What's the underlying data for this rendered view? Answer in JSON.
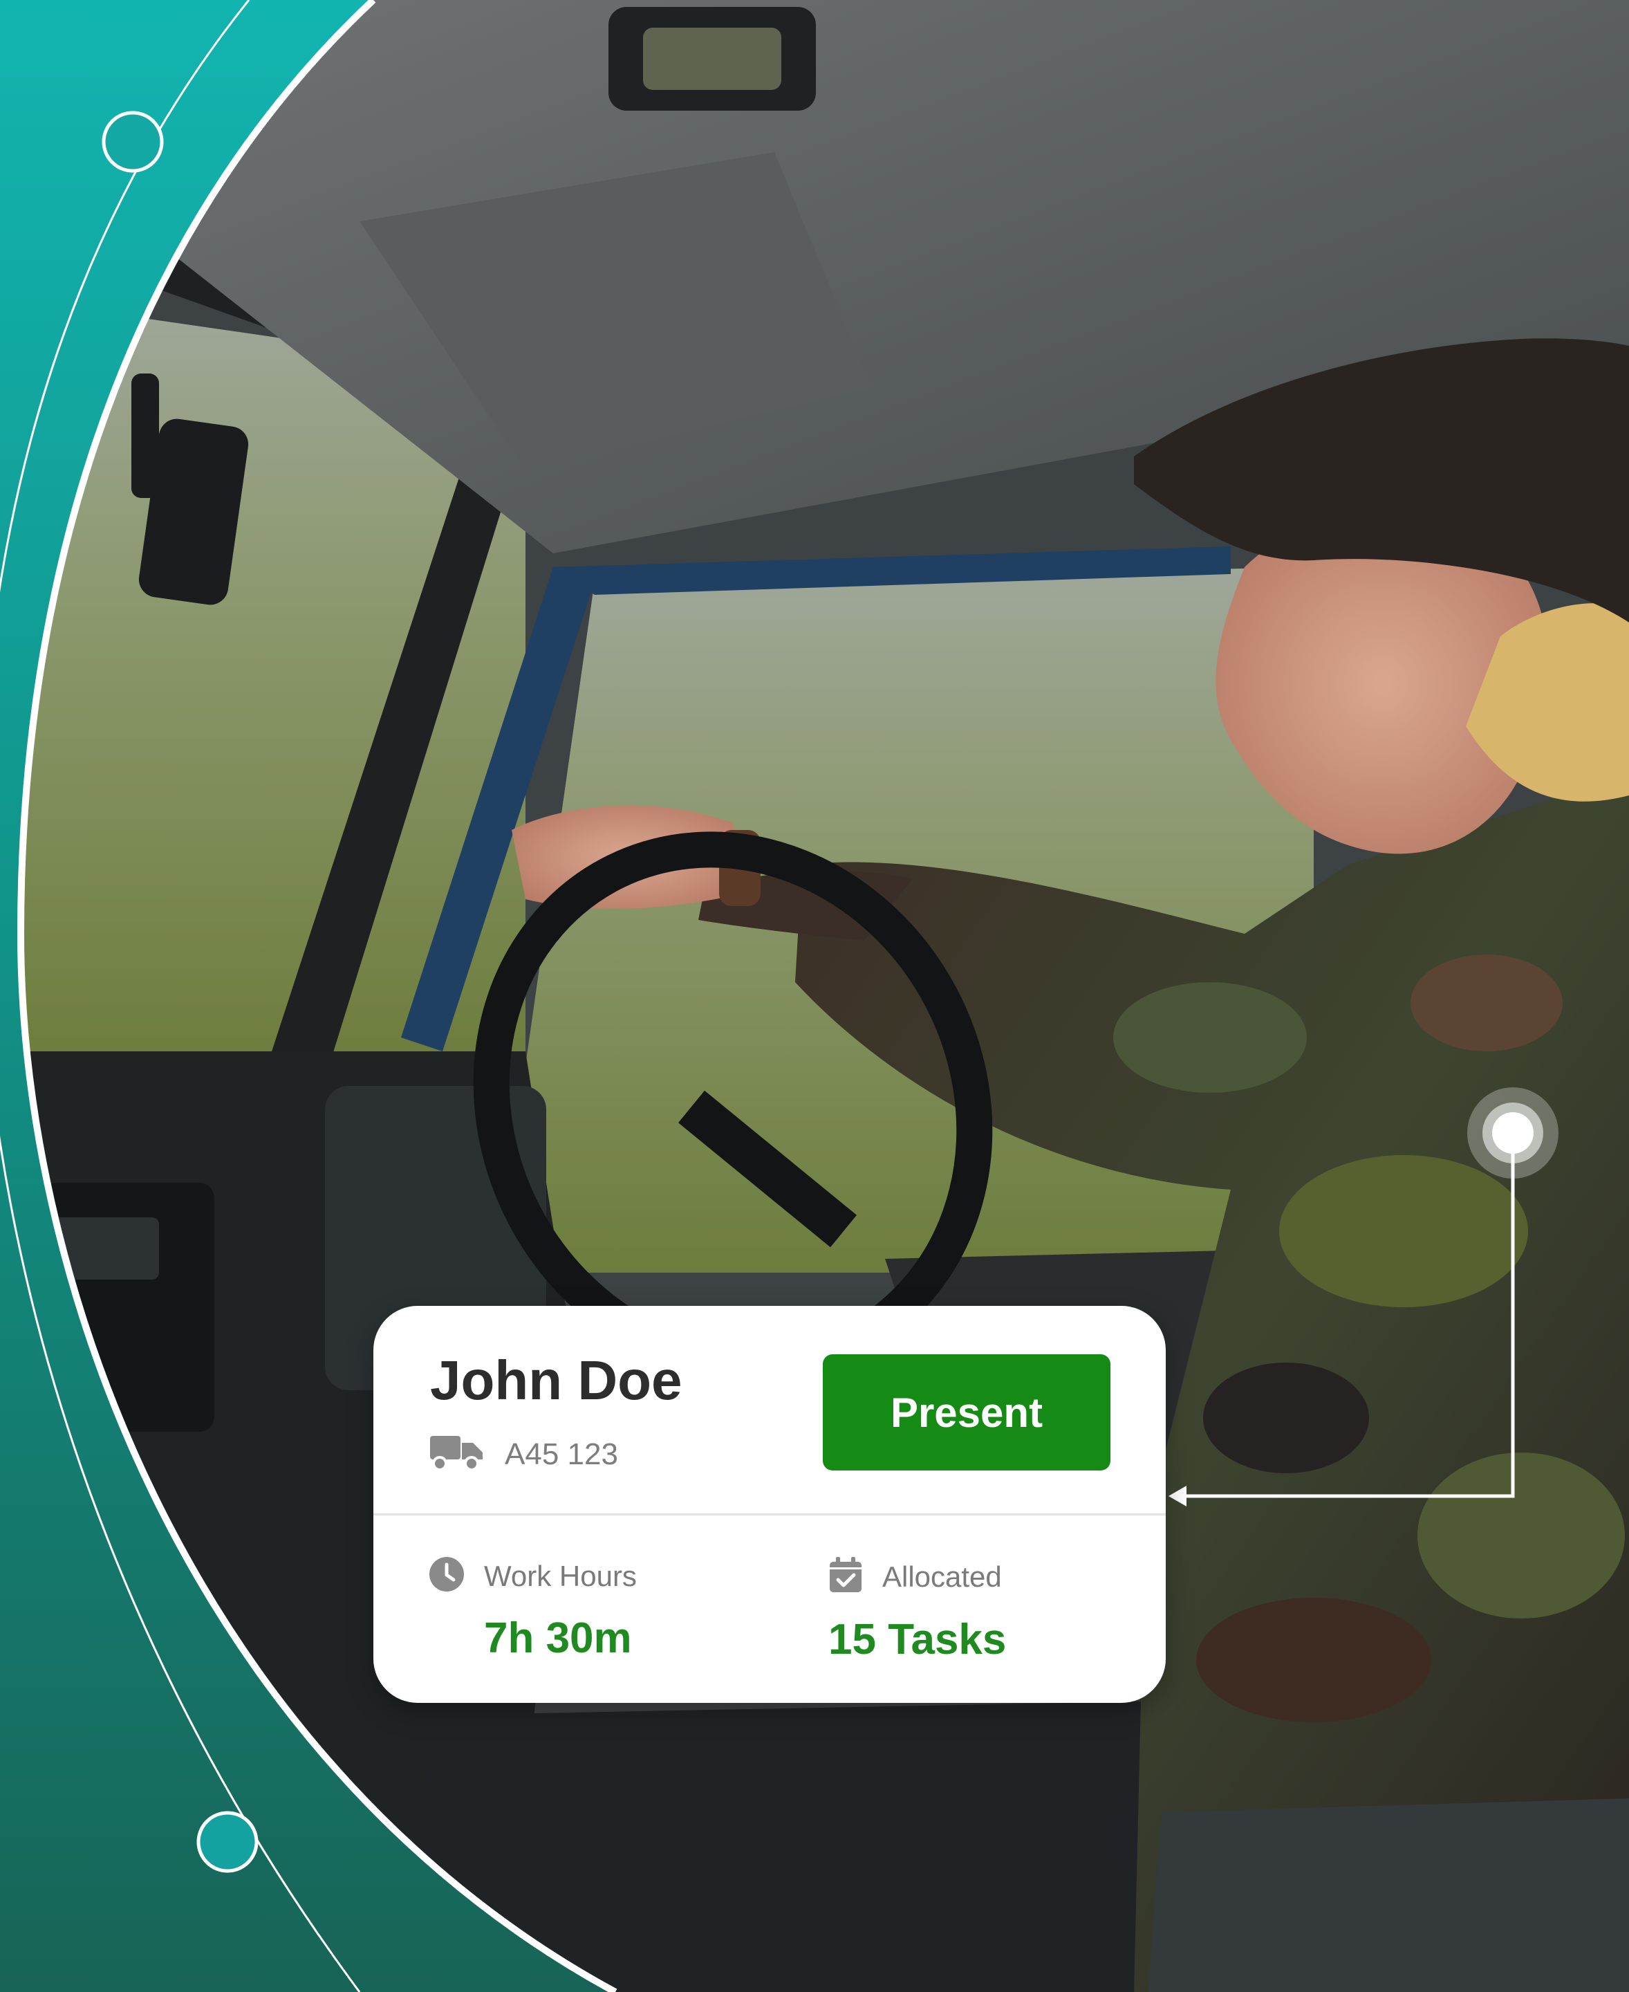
{
  "driver": {
    "name": "John Doe",
    "vehicle_id": "A45 123",
    "status": "Present"
  },
  "stats": {
    "work_hours": {
      "label": "Work Hours",
      "value": "7h 30m"
    },
    "allocated": {
      "label": "Allocated",
      "value": "15 Tasks"
    }
  },
  "icons": {
    "vehicle": "truck-icon",
    "work_hours": "clock-icon",
    "allocated": "calendar-check-icon"
  },
  "colors": {
    "brand_teal": "#10b0ad",
    "brand_dark_teal": "#166b5f",
    "status_present": "#158a15",
    "stat_value": "#1f8a1f"
  }
}
